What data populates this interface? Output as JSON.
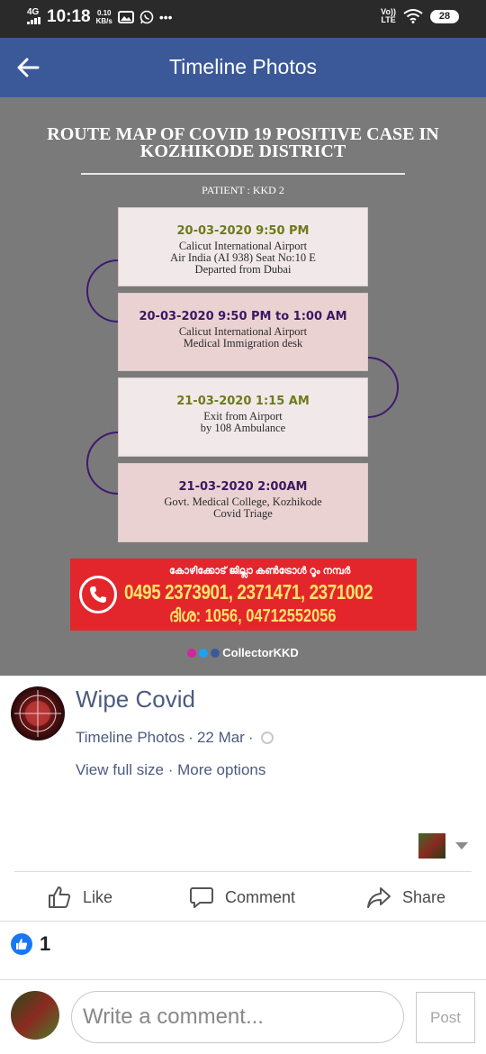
{
  "status_bar": {
    "network": "4G",
    "time": "10:18",
    "speed_value": "0.10",
    "speed_unit": "KB/s",
    "lte_top": "Vo))",
    "lte_bottom": "LTE",
    "battery": "28",
    "icons": [
      "signal-icon",
      "gallery-icon",
      "whatsapp-icon",
      "more-dots-icon",
      "wifi-icon"
    ]
  },
  "app_bar": {
    "title": "Timeline Photos",
    "back_icon": "back-arrow-icon",
    "color": "#3b5998"
  },
  "poster": {
    "title": "ROUTE MAP OF COVID 19 POSITIVE CASE IN KOZHIKODE DISTRICT",
    "patient": "PATIENT : KKD 2",
    "stops": [
      {
        "time": "20-03-2020 9:50 PM",
        "time_color": "#6d7a1a",
        "lines": [
          "Calicut International Airport",
          "Air India (AI 938) Seat No:10 E",
          "Departed from Dubai"
        ]
      },
      {
        "time": "20-03-2020 9:50 PM to 1:00 AM",
        "time_color": "#3a1860",
        "lines": [
          "Calicut International Airport",
          "Medical Immigration desk"
        ]
      },
      {
        "time": "21-03-2020 1:15 AM",
        "time_color": "#6d7a1a",
        "lines": [
          "Exit from Airport",
          "by 108 Ambulance"
        ]
      },
      {
        "time": "21-03-2020 2:00AM",
        "time_color": "#3a1860",
        "lines": [
          "Govt. Medical College, Kozhikode",
          "Covid Triage"
        ]
      }
    ],
    "helpline": {
      "heading": "കോഴിക്കോട് ജില്ലാ കൺട്രോൾ റൂം നമ്പർ",
      "numbers": "0495 2373901, 2371471, 2371002",
      "disha": "ദിശ: 1056, 04712552056"
    },
    "credit": "CollectorKKD"
  },
  "post": {
    "page_name": "Wipe Covid",
    "album": "Timeline Photos",
    "date": "22 Mar",
    "view_full_size": "View full size",
    "more_options": "More options",
    "separator": "·"
  },
  "actions": {
    "like": "Like",
    "comment": "Comment",
    "share": "Share"
  },
  "reactions": {
    "count": "1"
  },
  "composer": {
    "placeholder": "Write a comment...",
    "post_label": "Post"
  }
}
